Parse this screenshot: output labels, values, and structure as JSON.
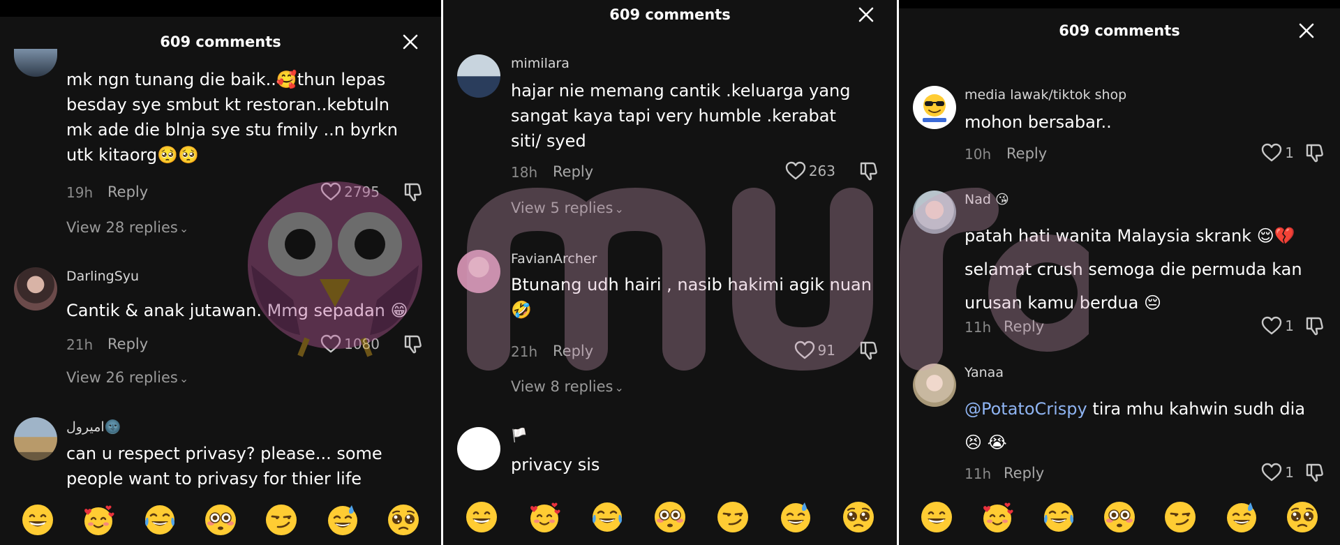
{
  "panels": [
    {
      "header_title": "609 comments",
      "comments": [
        {
          "username": "",
          "text": "mk ngn tunang die baik..🥰thun lepas besday sye smbut kt restoran..kebtuln mk ade die blnja sye stu fmily ..n byrkn utk kitaorg🥺🥺",
          "time": "19h",
          "reply": "Reply",
          "likes": "2795",
          "view_replies": "View 28 replies"
        },
        {
          "username": "DarlingSyu",
          "text": "Cantik & anak jutawan. Mmg sepadan 😁",
          "time": "21h",
          "reply": "Reply",
          "likes": "1080",
          "view_replies": "View 26 replies"
        },
        {
          "username": "اميرول🌚",
          "text": "can u respect privasy? please... some people want to privasy for thier life"
        }
      ]
    },
    {
      "header_title": "609 comments",
      "comments": [
        {
          "username": "mimilara",
          "text": "hajar nie memang cantik .keluarga yang sangat kaya tapi very humble .kerabat siti/ syed",
          "time": "18h",
          "reply": "Reply",
          "likes": "263",
          "view_replies": "View 5 replies"
        },
        {
          "username": "FavianArcher",
          "text": "Btunang udh hairi , nasib hakimi agik nuan 🤣",
          "time": "21h",
          "reply": "Reply",
          "likes": "91",
          "view_replies": "View 8 replies"
        },
        {
          "username": "🏳️",
          "text": "privacy sis"
        }
      ]
    },
    {
      "header_title": "609 comments",
      "comments": [
        {
          "username": "media lawak/tiktok shop",
          "text": "mohon bersabar..",
          "time": "10h",
          "reply": "Reply",
          "likes": "1"
        },
        {
          "username": "Nad 😘",
          "text": "patah hati wanita Malaysia skrank 😌💔 selamat crush semoga die permuda kan urusan kamu berdua 😔",
          "time": "11h",
          "reply": "Reply",
          "likes": "1"
        },
        {
          "username": "Yanaa",
          "mention": "@PotatoCrispy",
          "text": " tira mhu kahwin sudh dia😣 😭",
          "time": "11h",
          "reply": "Reply",
          "likes": "1"
        }
      ]
    }
  ],
  "emoji_bar": [
    "grinning",
    "smiling-hearts",
    "tears-of-joy",
    "flushed",
    "smirking",
    "sweat-smile",
    "pleading"
  ],
  "watermark": {
    "text": "murai"
  },
  "colors": {
    "background": "#121212",
    "text": "#ffffff",
    "muted": "#8a8a8a",
    "mention": "#8fb4f2"
  }
}
